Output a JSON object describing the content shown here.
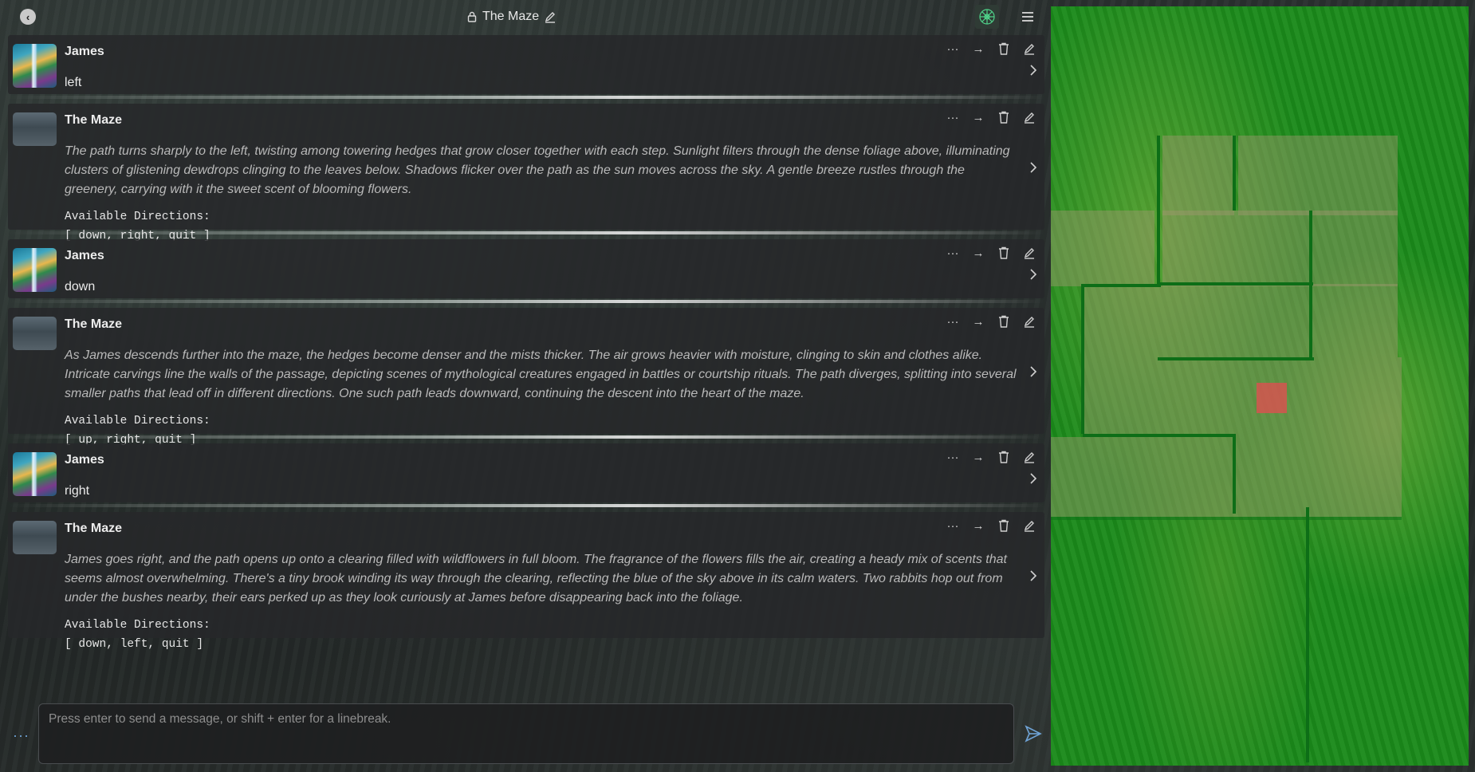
{
  "header": {
    "back_icon": "chevron-left-icon",
    "title": "The Maze",
    "lock_icon": "lock-icon",
    "edit_icon": "pencil-icon",
    "menu_icon": "hamburger-icon"
  },
  "messages": [
    {
      "author": "James",
      "type": "user",
      "text": "left"
    },
    {
      "author": "The Maze",
      "type": "narrator",
      "text": "The path turns sharply to the left, twisting among towering hedges that grow closer together with each step. Sunlight filters through the dense foliage above, illuminating clusters of glistening dewdrops clinging to the leaves below. Shadows flicker over the path as the sun moves across the sky. A gentle breeze rustles through the greenery, carrying with it the sweet scent of blooming flowers.",
      "dirs_label": "Available Directions:",
      "dirs": "[ down, right, quit ]"
    },
    {
      "author": "James",
      "type": "user",
      "text": "down"
    },
    {
      "author": "The Maze",
      "type": "narrator",
      "text": "As James descends further into the maze, the hedges become denser and the mists thicker. The air grows heavier with moisture, clinging to skin and clothes alike. Intricate carvings line the walls of the passage, depicting scenes of mythological creatures engaged in battles or courtship rituals. The path diverges, splitting into several smaller paths that lead off in different directions. One such path leads downward, continuing the descent into the heart of the maze.",
      "dirs_label": "Available Directions:",
      "dirs": "[ up, right, quit ]"
    },
    {
      "author": "James",
      "type": "user",
      "text": "right"
    },
    {
      "author": "The Maze",
      "type": "narrator",
      "text": "James goes right, and the path opens up onto a clearing filled with wildflowers in full bloom. The fragrance of the flowers fills the air, creating a heady mix of scents that seems almost overwhelming. There's a tiny brook winding its way through the clearing, reflecting the blue of the sky above in its calm waters. Two rabbits hop out from under the bushes nearby, their ears perked up as they look curiously at James before disappearing back into the foliage.",
      "dirs_label": "Available Directions:",
      "dirs": "[ down, left, quit ]"
    }
  ],
  "message_actions": [
    "more-icon",
    "forward-icon",
    "trash-icon",
    "edit-icon"
  ],
  "composer": {
    "placeholder": "Press enter to send a message, or shift + enter for a linebreak.",
    "options_label": "···",
    "send_icon": "send-icon"
  },
  "map": {
    "colors": {
      "grass": "#1a8a1a",
      "wall": "#0d6e17",
      "player": "#dc5050"
    }
  }
}
